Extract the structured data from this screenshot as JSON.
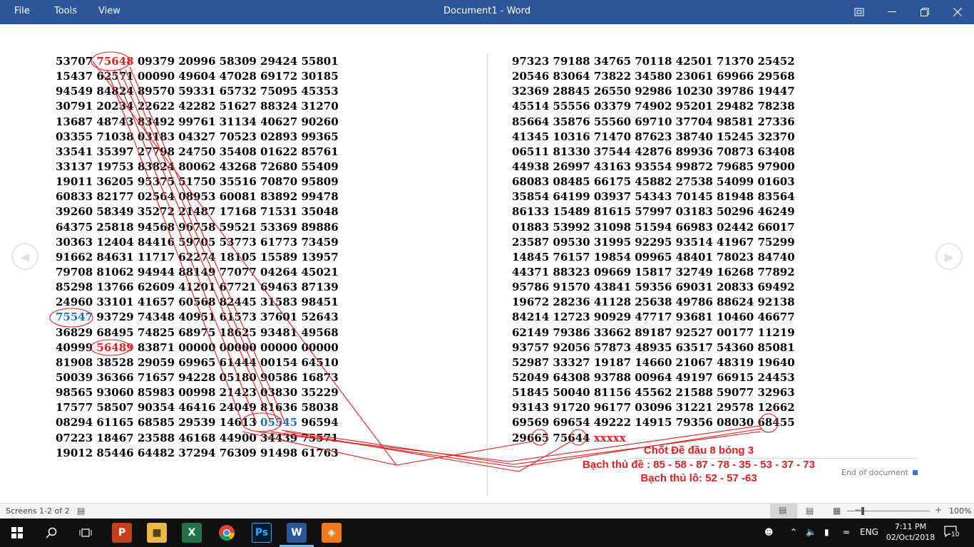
{
  "titlebar": {
    "title": "Document1  -  Word",
    "menu": [
      "File",
      "Tools",
      "View"
    ]
  },
  "document": {
    "left_rows": [
      [
        {
          "t": "53707 "
        },
        {
          "t": "75648",
          "c": "red"
        },
        {
          "t": " 09379 20996 58309 29424 55801"
        }
      ],
      [
        {
          "t": "15437 62571 00090 49604 47028 69172 30185"
        }
      ],
      [
        {
          "t": "94549 84824 89570 59331 65732 75095 45353"
        }
      ],
      [
        {
          "t": "30791 20234 22622 42282 51627 88324 31270"
        }
      ],
      [
        {
          "t": "13687 48743 83492 99761 31134 40627 90260"
        }
      ],
      [
        {
          "t": "03355 71038 03183 04327 70523 02893 99365"
        }
      ],
      [
        {
          "t": "33541 35397 27798 24750 35408 01622 85761"
        }
      ],
      [
        {
          "t": "33137 19753 83824 80062 43268 72680 55409"
        }
      ],
      [
        {
          "t": "19011 36205 95375 51750 35516 70870 95809"
        }
      ],
      [
        {
          "t": "60833 82177 02564 08953 60081 83892 99478"
        }
      ],
      [
        {
          "t": "39260 58349 35272 21487 17168 71531 35048"
        }
      ],
      [
        {
          "t": "64375 25818 94568 96758 59521 53369 89886"
        }
      ],
      [
        {
          "t": "30363 12404 84416 59705 53773 61773 73459"
        }
      ],
      [
        {
          "t": "91662 84631 11717 62274 18105 15589 13957"
        }
      ],
      [
        {
          "t": "79708 81062 94944 88149 77077 04264 45021"
        }
      ],
      [
        {
          "t": "85298 13766 62609 41201 67721 69463 87139"
        }
      ],
      [
        {
          "t": "24960 33101 41657 60568 82445 31583 98451"
        }
      ],
      [
        {
          "t": "75547",
          "c": "blue"
        },
        {
          "t": " 93729 74348 40951 61573 37601 52643"
        }
      ],
      [
        {
          "t": "36829 68495 74825 68975 18625 93481 49568"
        }
      ],
      [
        {
          "t": "40999 "
        },
        {
          "t": "56489",
          "c": "red"
        },
        {
          "t": " 83871 00000 00000 00000 00000"
        }
      ],
      [
        {
          "t": "81908 38528 29059 69965 61444 00154 64510"
        }
      ],
      [
        {
          "t": "50039 36366 71657 94228 05180 90586 16873"
        }
      ],
      [
        {
          "t": "98565 93060 85983 00998 21423 03830 35229"
        }
      ],
      [
        {
          "t": "17577 58507 90354 46416 24049 81636 58038"
        }
      ],
      [
        {
          "t": "08294 61165 68585 29539 14613 "
        },
        {
          "t": "05545",
          "c": "blue"
        },
        {
          "t": " 96594"
        }
      ],
      [
        {
          "t": "07223 18467 23588 46168 44900 34439 75571"
        }
      ],
      [
        {
          "t": "19012 85446 64482 37294 76309 91498 61763"
        }
      ]
    ],
    "right_rows": [
      [
        {
          "t": "97323 79188 34765 70118 42501 71370 25452"
        }
      ],
      [
        {
          "t": "20546 83064 73822 34580 23061 69966 29568"
        }
      ],
      [
        {
          "t": "32369 28845 26550 92986 10230 39786 19447"
        }
      ],
      [
        {
          "t": "45514 55556 03379 74902 95201 29482 78238"
        }
      ],
      [
        {
          "t": "85664 35876 55560 69710 37704 98581 27336"
        }
      ],
      [
        {
          "t": "41345 10316 71470 87623 38740 15245 32370"
        }
      ],
      [
        {
          "t": "06511 81330 37544 42876 89936 70873 63408"
        }
      ],
      [
        {
          "t": "44938 26997 43163 93554 99872 79685 97900"
        }
      ],
      [
        {
          "t": "68083 08485 66175 45882 27538 54099 01603"
        }
      ],
      [
        {
          "t": "35854 64199 03937 54343 70145 81948 83564"
        }
      ],
      [
        {
          "t": "86133 15489 81615 57997 03183 50296 46249"
        }
      ],
      [
        {
          "t": "01883 53992 31098 51594 66983 02442 66017"
        }
      ],
      [
        {
          "t": "23587 09530 31995 92295 93514 41967 75299"
        }
      ],
      [
        {
          "t": "14845 76157 19854 09965 48401 78023 84740"
        }
      ],
      [
        {
          "t": "44371 88323 09669 15817 32749 16268 77892"
        }
      ],
      [
        {
          "t": "95786 91570 43841 59356 69031 20833 69492"
        }
      ],
      [
        {
          "t": "19672 28236 41128 25638 49786 88624 92138"
        }
      ],
      [
        {
          "t": "84214 12723 90929 47717 93681 10460 46677"
        }
      ],
      [
        {
          "t": "62149 79386 33662 89187 92527 00177 11219"
        }
      ],
      [
        {
          "t": "93757 92056 57873 48935 63517 54360 85081"
        }
      ],
      [
        {
          "t": "52987 33327 19187 14660 21067 48319 19640"
        }
      ],
      [
        {
          "t": "52049 64308 93788 00964 49197 66915 24453"
        }
      ],
      [
        {
          "t": "51845 50040 81156 45562 21588 59077 32963"
        }
      ],
      [
        {
          "t": "93143 91720 96177 03096 31221 29578 12662"
        }
      ],
      [
        {
          "t": "69569 69654 49222 14915 79356 08030 68455"
        }
      ],
      [
        {
          "t": "29665 75644 "
        },
        {
          "t": "xxxxx",
          "c": "red"
        }
      ]
    ],
    "annotation": {
      "line1": "Chốt Đề đầu 8 bóng 3",
      "line2": "Bạch thủ đề : 85 - 58 - 87 - 78 - 35 - 53 - 37 - 73",
      "line3": "Bạch thủ lô: 52 - 57 -63"
    },
    "end_label": "End of document"
  },
  "statusbar": {
    "screens": "Screens 1-2 of 2",
    "zoom": "100%"
  },
  "taskbar": {
    "lang": "ENG",
    "time": "7:11 PM",
    "date": "02/Oct/2018",
    "notifications": "10"
  },
  "colors": {
    "titlebar": "#2b579a",
    "highlight_red": "#e02020",
    "highlight_blue": "#1f6fbf"
  }
}
